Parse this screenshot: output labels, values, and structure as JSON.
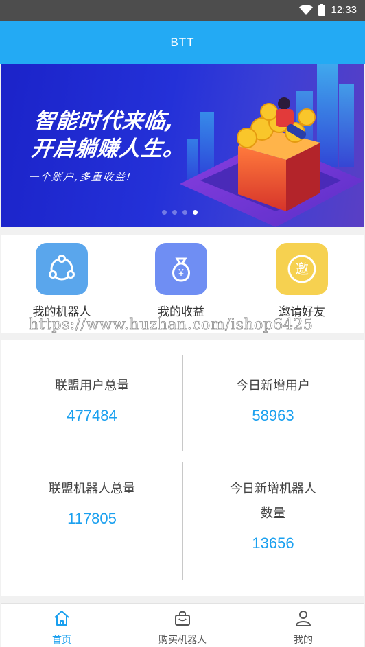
{
  "status_bar": {
    "time": "12:33"
  },
  "app_bar": {
    "title": "BTT"
  },
  "banner": {
    "line1": "智能时代来临,",
    "line2": "开启躺赚人生。",
    "line3": "一个账户,多重收益!",
    "slide_count": 4,
    "active_slide": 4
  },
  "menu": {
    "items": [
      {
        "label": "我的机器人",
        "icon": "share-nodes-icon",
        "color": "#5aa6ec"
      },
      {
        "label": "我的收益",
        "icon": "money-bag-icon",
        "color": "#6f8ef3"
      },
      {
        "label": "邀请好友",
        "icon": "invite-badge-icon",
        "color": "#f6d150",
        "glyph": "邀"
      }
    ]
  },
  "watermark": "https://www.huzhan.com/ishop6425",
  "stats": {
    "total_users_label": "联盟用户总量",
    "total_users_value": "477484",
    "new_users_label": "今日新增用户",
    "new_users_value": "58963",
    "total_robots_label": "联盟机器人总量",
    "total_robots_value": "117805",
    "new_robots_label_1": "今日新增机器人",
    "new_robots_label_2": "数量",
    "new_robots_value": "13656"
  },
  "bottom_nav": {
    "items": [
      {
        "label": "首页",
        "icon": "home-icon",
        "active": true
      },
      {
        "label": "购买机器人",
        "icon": "shopping-bag-icon",
        "active": false
      },
      {
        "label": "我的",
        "icon": "user-icon",
        "active": false
      }
    ]
  },
  "colors": {
    "primary": "#23aaf4",
    "accent_text": "#1aa0ef"
  }
}
